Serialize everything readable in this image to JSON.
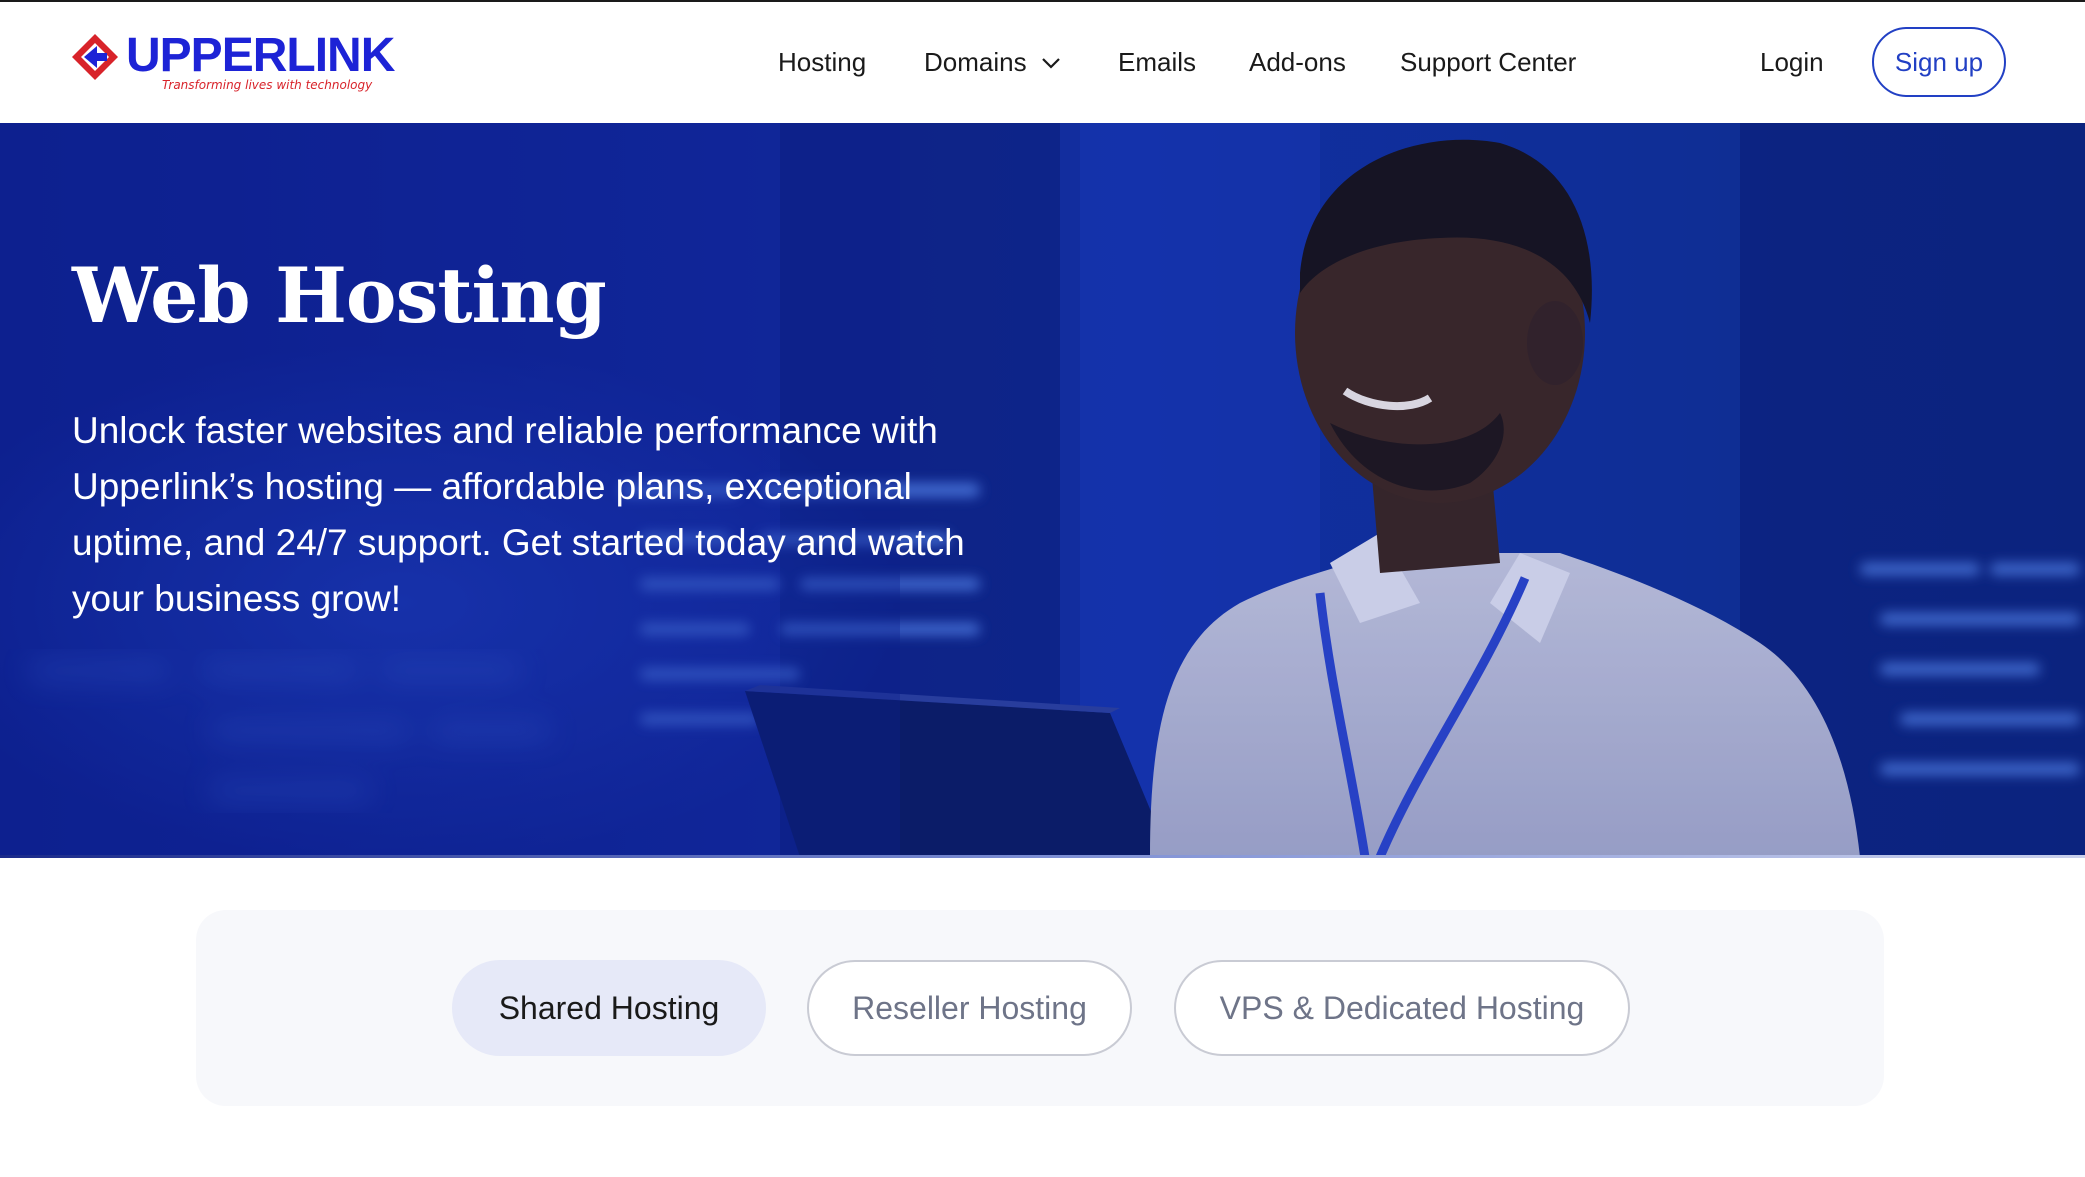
{
  "brand": {
    "name": "UPPERLINK",
    "tagline": "Transforming lives with technology",
    "colors": {
      "primary": "#1d23d6",
      "accent": "#d8232a"
    }
  },
  "nav": {
    "items": [
      {
        "label": "Hosting"
      },
      {
        "label": "Domains",
        "icon": "chevron-down-icon"
      },
      {
        "label": "Emails"
      },
      {
        "label": "Add-ons"
      },
      {
        "label": "Support Center"
      }
    ],
    "login": "Login",
    "signup": "Sign up"
  },
  "hero": {
    "title": "Web Hosting",
    "description": "Unlock faster websites and reliable performance with Upperlink’s hosting — affordable plans, exceptional uptime, and 24/7 support. Get started today and watch your business grow!"
  },
  "tabs": [
    {
      "label": "Shared Hosting",
      "active": true
    },
    {
      "label": "Reseller Hosting",
      "active": false
    },
    {
      "label": "VPS & Dedicated Hosting",
      "active": false
    }
  ]
}
